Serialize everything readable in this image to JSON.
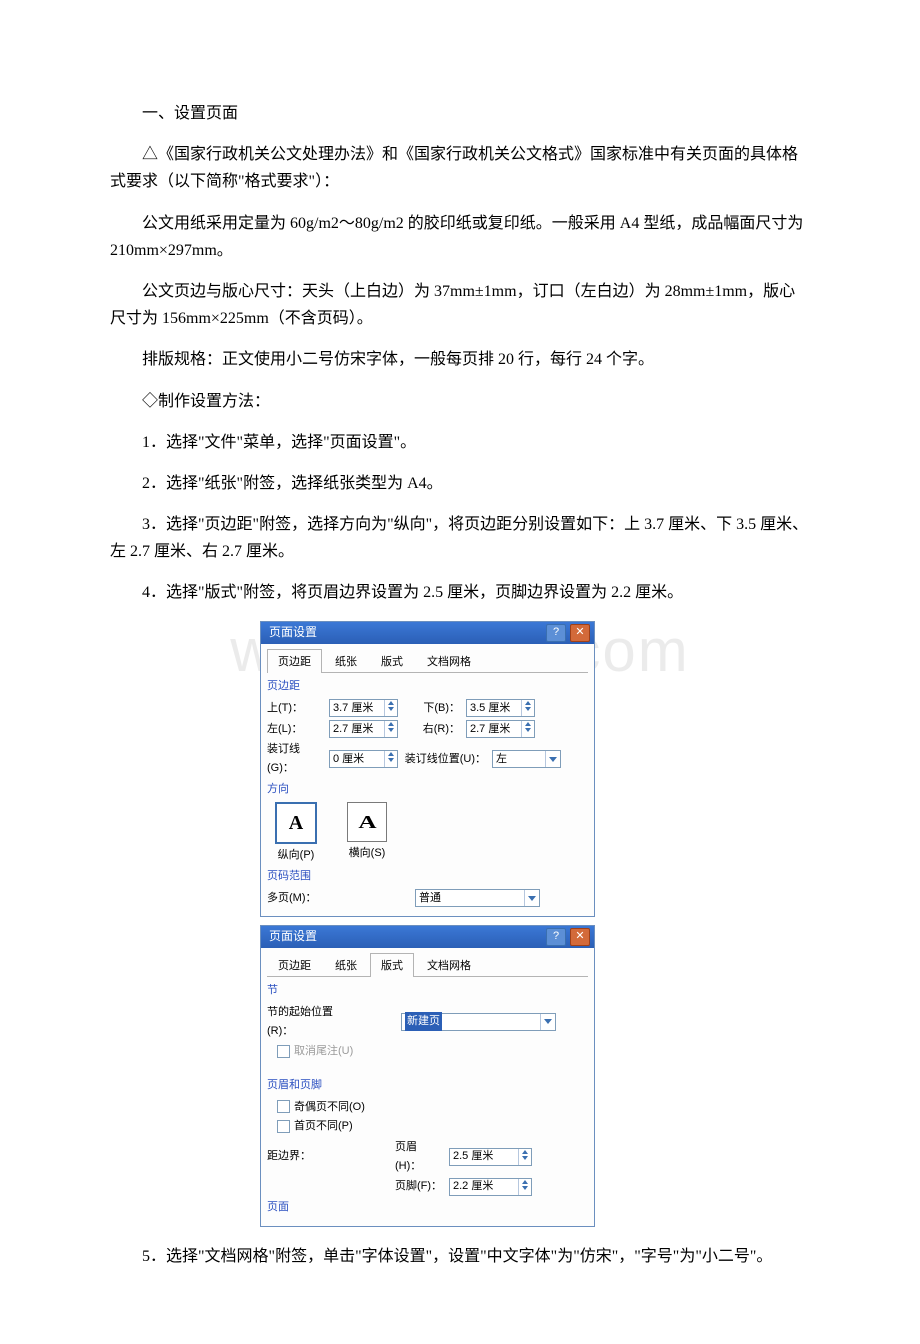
{
  "text": {
    "h1": "一、设置页面",
    "p1": "△《国家行政机关公文处理办法》和《国家行政机关公文格式》国家标准中有关页面的具体格式要求（以下简称\"格式要求\"）：",
    "p2": "公文用纸采用定量为 60g/m2～80g/m2 的胶印纸或复印纸。一般采用 A4 型纸，成品幅面尺寸为 210mm×297mm。",
    "p3": "公文页边与版心尺寸：天头（上白边）为 37mm±1mm，订口（左白边）为 28mm±1mm，版心尺寸为 156mm×225mm（不含页码）。",
    "p4": "排版规格：正文使用小二号仿宋字体，一般每页排 20 行，每行 24 个字。",
    "p5": "◇制作设置方法：",
    "p6": "1．选择\"文件\"菜单，选择\"页面设置\"。",
    "p7": "2．选择\"纸张\"附签，选择纸张类型为 A4。",
    "p8": "3．选择\"页边距\"附签，选择方向为\"纵向\"，将页边距分别设置如下：上 3.7 厘米、下 3.5 厘米、左 2.7 厘米、右 2.7 厘米。",
    "p9": "4．选择\"版式\"附签，将页眉边界设置为 2.5 厘米，页脚边界设置为 2.2 厘米。",
    "p10": "5．选择\"文档网格\"附签，单击\"字体设置\"，设置\"中文字体\"为\"仿宋\"，\"字号\"为\"小二号\"。"
  },
  "dlg1": {
    "title": "页面设置",
    "tabs": {
      "margins": "页边距",
      "paper": "纸张",
      "layout": "版式",
      "grid": "文档网格"
    },
    "group_margins": "页边距",
    "labels": {
      "top": "上(T)：",
      "bottom": "下(B)：",
      "left": "左(L)：",
      "right": "右(R)：",
      "gutter": "装订线(G)：",
      "gutter_pos": "装订线位置(U)："
    },
    "values": {
      "top": "3.7 厘米",
      "bottom": "3.5 厘米",
      "left": "2.7 厘米",
      "right": "2.7 厘米",
      "gutter": "0 厘米",
      "gutter_pos": "左"
    },
    "group_orient": "方向",
    "orient": {
      "portrait": "纵向(P)",
      "landscape": "横向(S)"
    },
    "group_range": "页码范围",
    "labels2": {
      "multi": "多页(M)："
    },
    "values2": {
      "multi": "普通"
    }
  },
  "dlg2": {
    "title": "页面设置",
    "tabs": {
      "margins": "页边距",
      "paper": "纸张",
      "layout": "版式",
      "grid": "文档网格"
    },
    "group_section": "节",
    "labels": {
      "start": "节的起始位置(R)：",
      "suppress": "取消尾注(U)"
    },
    "values": {
      "start": "新建页"
    },
    "group_hf": "页眉和页脚",
    "chk_oddeven": "奇偶页不同(O)",
    "chk_first": "首页不同(P)",
    "lbl_border": "距边界：",
    "lbl_header": "页眉(H)：",
    "lbl_footer": "页脚(F)：",
    "val_header": "2.5 厘米",
    "val_footer": "2.2 厘米",
    "group_page": "页面"
  },
  "watermark": "www.bdocx.com"
}
